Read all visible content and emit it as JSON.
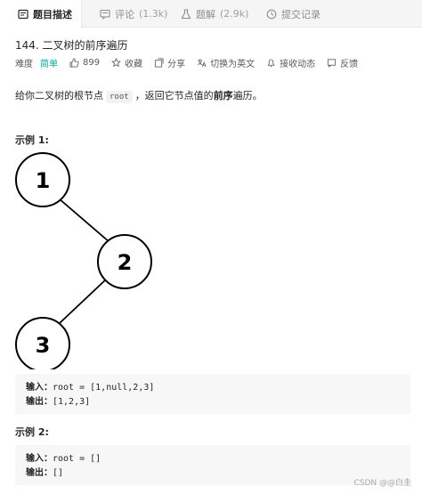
{
  "tabs": [
    {
      "label": "题目描述",
      "count": "",
      "icon": "doc-icon"
    },
    {
      "label": "评论",
      "count": "(1.3k)",
      "icon": "comment-icon"
    },
    {
      "label": "题解",
      "count": "(2.9k)",
      "icon": "flask-icon"
    },
    {
      "label": "提交记录",
      "count": "",
      "icon": "clock-icon"
    }
  ],
  "problem": {
    "title": "144. 二叉树的前序遍历",
    "difficulty_label": "难度",
    "difficulty": "简单",
    "likes": "899",
    "favorite": "收藏",
    "share": "分享",
    "switch_lang": "切换为英文",
    "notify": "接收动态",
    "feedback": "反馈",
    "desc_pre": "给你二叉树的根节点",
    "desc_code": "root",
    "desc_mid": "，返回它节点值的",
    "desc_bold": "前序",
    "desc_post": "遍历。"
  },
  "colors": {
    "easy": "#00af9b"
  },
  "example1": {
    "title": "示例 1:",
    "nodes": [
      "1",
      "2",
      "3"
    ],
    "input_label": "输入：",
    "input_value": "root = [1,null,2,3]",
    "output_label": "输出：",
    "output_value": "[1,2,3]"
  },
  "example2": {
    "title": "示例 2:",
    "input_label": "输入：",
    "input_value": "root = []",
    "output_label": "输出：",
    "output_value": "[]"
  },
  "watermark": "CSDN @@白圭"
}
